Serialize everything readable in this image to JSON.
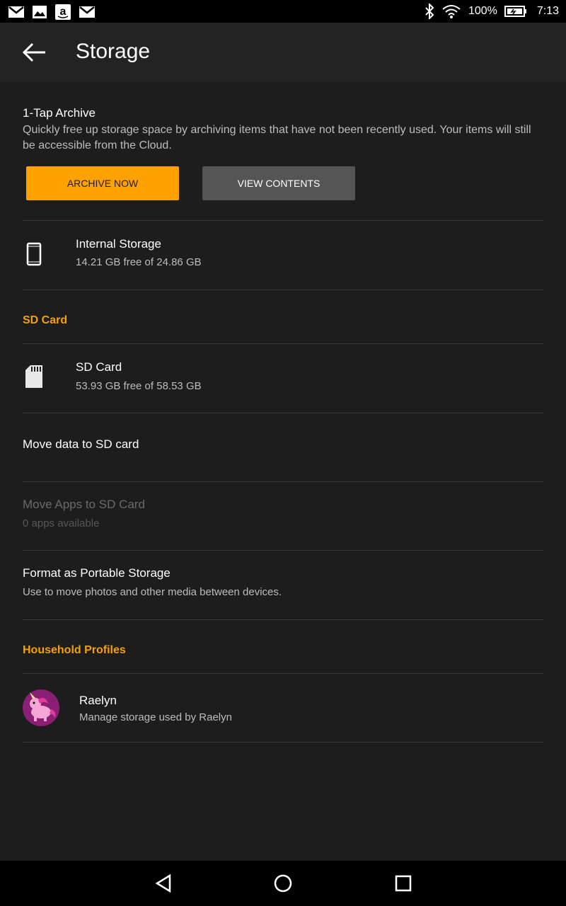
{
  "status_bar": {
    "battery_percent": "100%",
    "time": "7:13"
  },
  "app_bar": {
    "title": "Storage"
  },
  "archive": {
    "title": "1-Tap Archive",
    "description": "Quickly free up storage space by archiving items that have not been recently used. Your items will still be accessible from the Cloud.",
    "archive_now_label": "ARCHIVE NOW",
    "view_contents_label": "VIEW CONTENTS",
    "archive_color": "#FFA200",
    "view_color": "#555555"
  },
  "internal_storage": {
    "title": "Internal Storage",
    "subtitle": "14.21 GB free of 24.86 GB"
  },
  "sd_section": {
    "header": "SD Card"
  },
  "sd_card": {
    "title": "SD Card",
    "subtitle": "53.93 GB free of 58.53 GB"
  },
  "move_data": {
    "title": "Move data to SD card"
  },
  "move_apps": {
    "title": "Move Apps to SD Card",
    "subtitle": "0 apps available"
  },
  "format": {
    "title": "Format as Portable Storage",
    "subtitle": "Use to move photos and other media between devices."
  },
  "household": {
    "header": "Household Profiles",
    "profile": {
      "name": "Raelyn",
      "subtitle": "Manage storage used by Raelyn"
    }
  },
  "icons": [
    "mail-icon",
    "image-icon",
    "amazon-icon",
    "mail-icon",
    "bluetooth-icon",
    "wifi-icon",
    "battery-icon",
    "back-arrow-icon",
    "phone-icon",
    "sd-card-icon",
    "unicorn-avatar",
    "nav-back-icon",
    "nav-home-icon",
    "nav-recents-icon"
  ]
}
